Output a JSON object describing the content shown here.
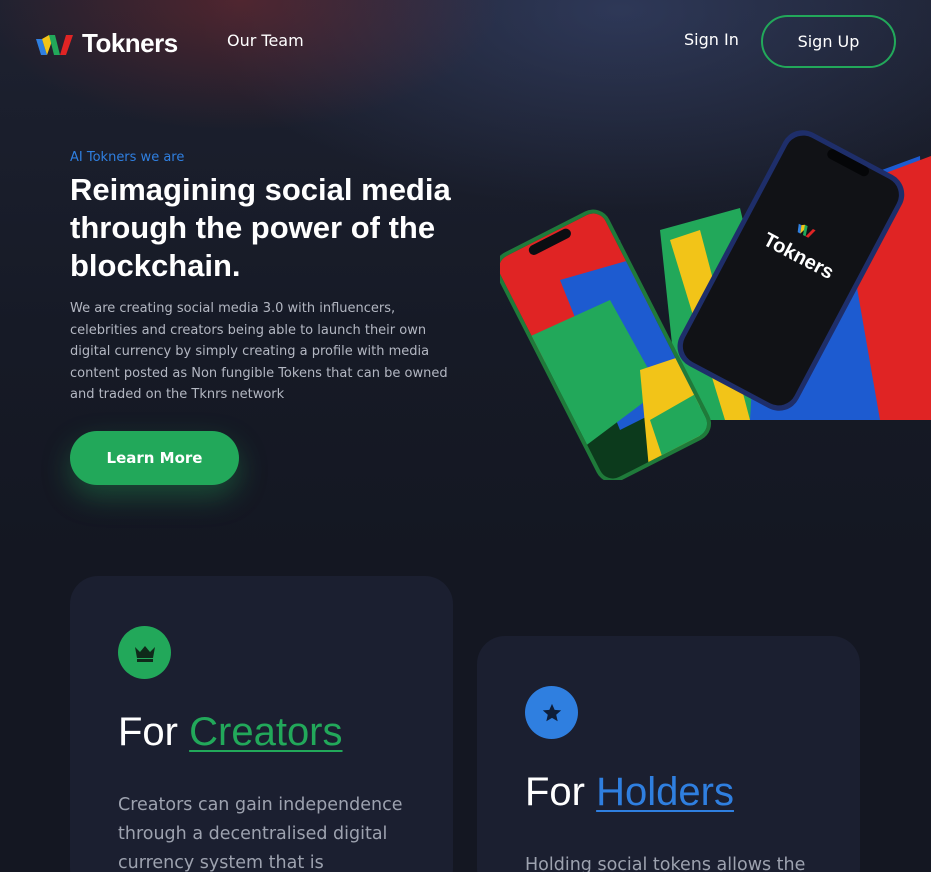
{
  "brand": {
    "name": "Tokners",
    "colors": {
      "green": "#22a85a",
      "blue": "#2f7fe0",
      "red": "#e02424",
      "yellow": "#f2c418"
    }
  },
  "nav": {
    "team": "Our Team",
    "sign_in": "Sign In",
    "sign_up": "Sign Up"
  },
  "hero": {
    "eyebrow": "AI Tokners we are",
    "title": "Reimagining social media through the power of the blockchain.",
    "description": "We are creating social media 3.0 with influencers, celebrities and creators being able to launch their own digital currency by simply creating a profile with media content posted as Non fungible Tokens that can be owned and traded on the Tknrs network",
    "cta": "Learn More",
    "phone_brand": "Tokners"
  },
  "cards": {
    "creators": {
      "icon": "crown-icon",
      "title_prefix": "For",
      "title_highlight": "Creators",
      "text": "Creators can gain independence through a decentralised digital currency system that is"
    },
    "holders": {
      "icon": "star-icon",
      "title_prefix": "For",
      "title_highlight": "Holders",
      "text": "Holding social tokens allows the"
    }
  }
}
